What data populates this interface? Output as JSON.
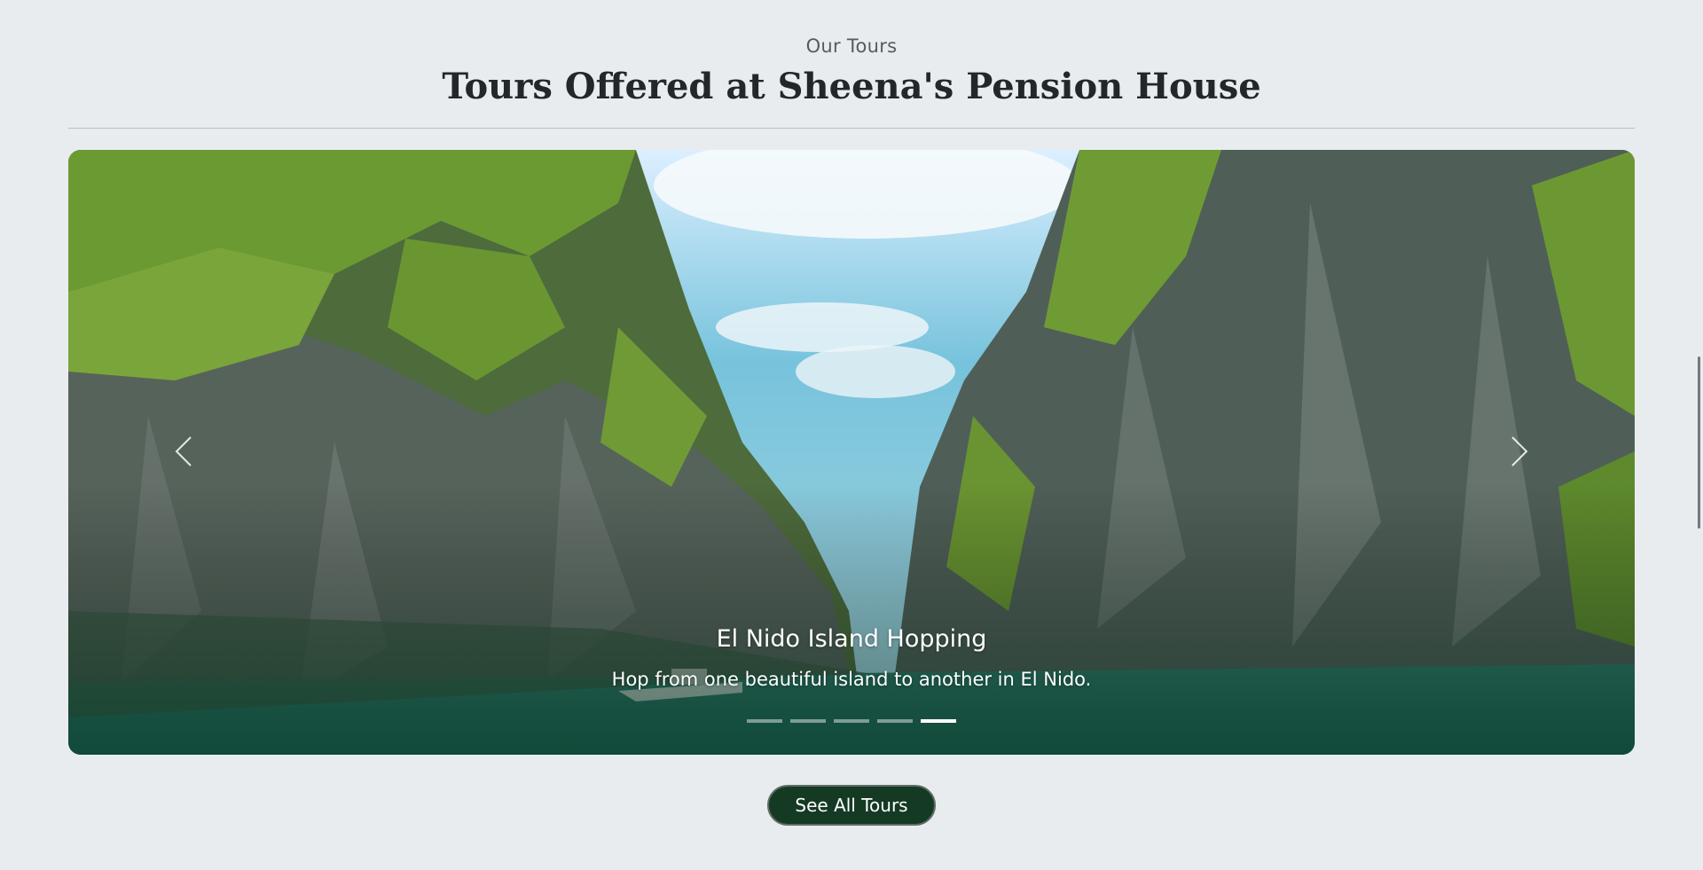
{
  "section": {
    "eyebrow": "Our Tours",
    "title": "Tours Offered at Sheena's Pension House"
  },
  "carousel": {
    "slide_count": 5,
    "active_index": 4,
    "caption_title": "El Nido Island Hopping",
    "caption_text": "Hop from one beautiful island to another in El Nido.",
    "prev_icon": "chevron-left-icon",
    "next_icon": "chevron-right-icon"
  },
  "cta": {
    "label": "See All Tours"
  },
  "colors": {
    "background": "#e9ecef",
    "button": "#153a24",
    "title": "#23272b"
  }
}
